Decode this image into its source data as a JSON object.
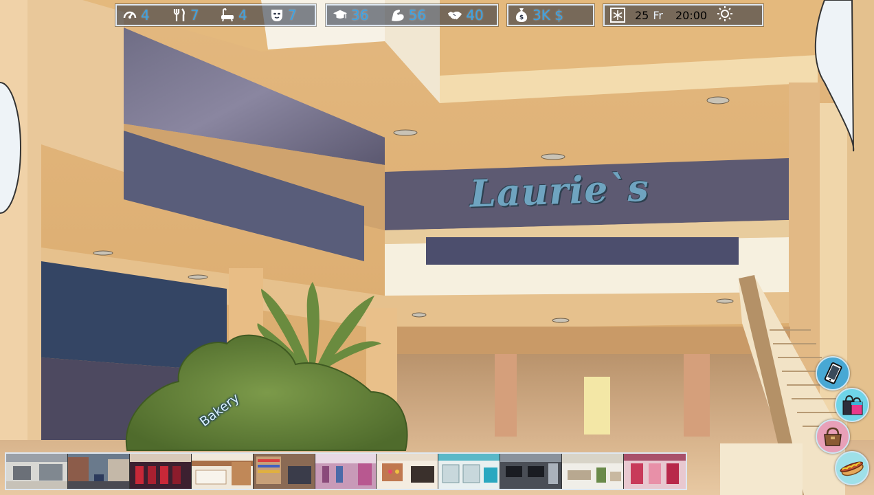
{
  "hud": {
    "energy": "4",
    "hunger": "7",
    "hygiene": "4",
    "mood": "7",
    "intelligence": "36",
    "fitness": "56",
    "charisma": "40",
    "money": "3K $",
    "date": "25",
    "weekday": "Fr",
    "time": "20:00",
    "season_icon": "snowflake-icon",
    "weather_icon": "sun-icon"
  },
  "scene": {
    "store_sign": "Laurie`s",
    "hotspot_label": "Bakery"
  },
  "locations": [
    "mall-hall",
    "street",
    "arcade",
    "bakery",
    "bookstore",
    "clothing-store",
    "sweet-shop",
    "pet-store",
    "electronics-store",
    "furniture-store",
    "lingerie-store"
  ],
  "side_buttons": [
    "phone-icon",
    "shopping-bag-icon",
    "handbag-icon",
    "hotdog-icon"
  ],
  "colors": {
    "hud_value": "#3aa2e4",
    "hud_border": "#dfe8f2",
    "sign_text": "#6fa4c0"
  }
}
